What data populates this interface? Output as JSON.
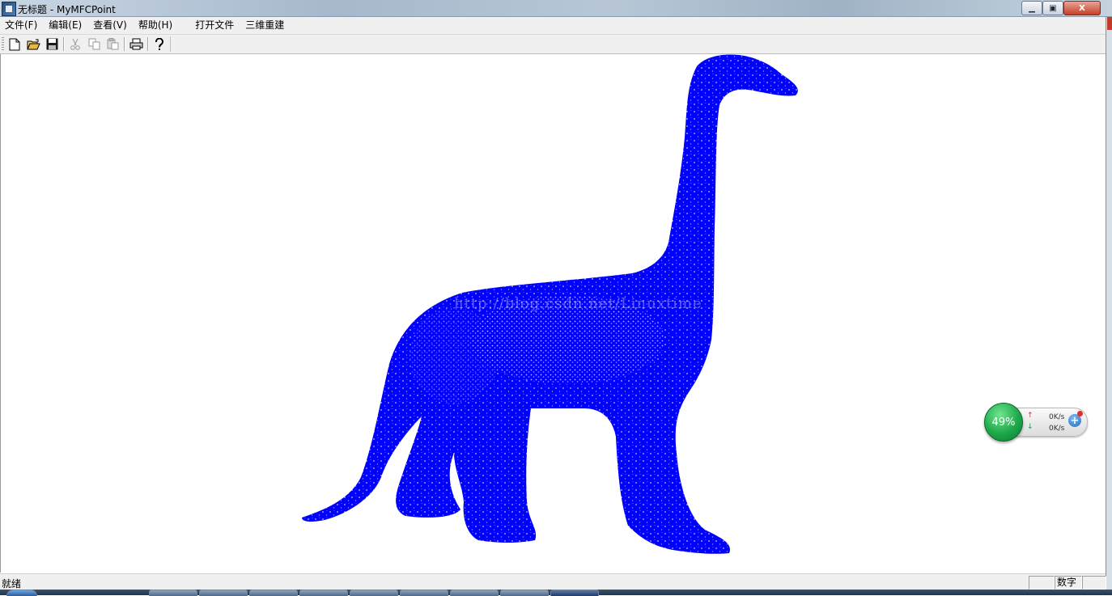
{
  "window": {
    "title": "无标题 - MyMFCPoint",
    "minimize_symbol": "▁",
    "maximize_symbol": "▣",
    "close_symbol": "X"
  },
  "menu": {
    "items": [
      "文件(F)",
      "编辑(E)",
      "查看(V)",
      "帮助(H)",
      "打开文件",
      "三维重建"
    ]
  },
  "toolbar": {
    "buttons": [
      "new-icon",
      "open-folder-icon",
      "save-icon",
      "cut-icon",
      "copy-icon",
      "paste-icon",
      "print-icon",
      "help-icon"
    ]
  },
  "canvas": {
    "point_cloud_color": "#0000ff",
    "subject": "dinosaur point cloud",
    "watermark": "http://blog.csdn.net/Linuxtime"
  },
  "net_widget": {
    "percent": "49%",
    "upload": "0K/s",
    "download": "0K/s",
    "plus": "+"
  },
  "status": {
    "text": "就绪",
    "pane_num": "数字"
  },
  "colors": {
    "point_cloud": "#0000ff",
    "chrome": "#f0f0f0"
  }
}
